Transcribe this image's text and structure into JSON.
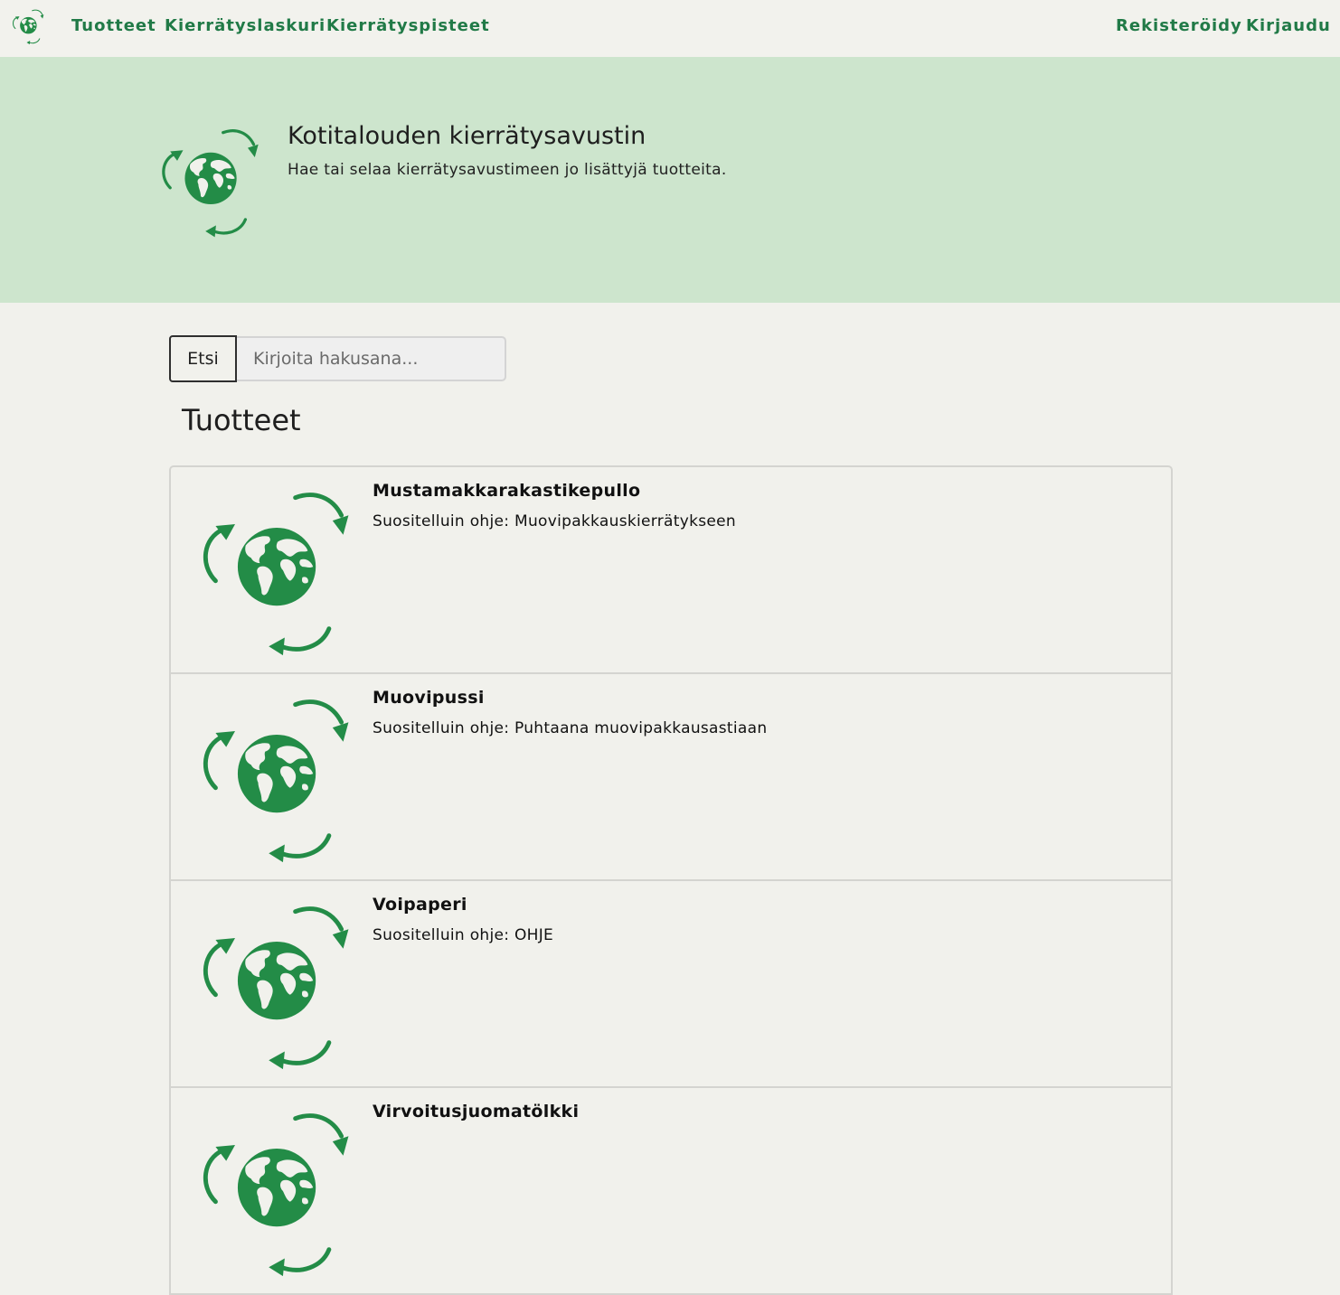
{
  "navbar": {
    "logo_icon": "recycling-globe-icon",
    "links": [
      "Tuotteet",
      "Kierrätyslaskuri",
      "Kierrätyspisteet"
    ],
    "register_label": "Rekisteröidy",
    "login_label": "Kirjaudu",
    "accent_color": "#217a47"
  },
  "hero": {
    "title": "Kotitalouden kierrätysavustin",
    "subtitle": "Hae tai selaa kierrätysavustimeen jo lisättyjä tuotteita.",
    "background_color": "#cde5cd"
  },
  "search": {
    "button_label": "Etsi",
    "placeholder": "Kirjoita hakusana...",
    "value": ""
  },
  "products_section": {
    "title": "Tuotteet",
    "items": [
      {
        "name": "Mustamakkarakastikepullo",
        "guide": "Suositelluin ohje: Muovipakkauskierrätykseen"
      },
      {
        "name": "Muovipussi",
        "guide": "Suositelluin ohje: Puhtaana muovipakkausastiaan"
      },
      {
        "name": "Voipaperi",
        "guide": "Suositelluin ohje: OHJE"
      },
      {
        "name": "Virvoitusjuomatölkki",
        "guide": ""
      }
    ]
  },
  "colors": {
    "green": "#238c47",
    "page_background": "#f1f1ec"
  }
}
